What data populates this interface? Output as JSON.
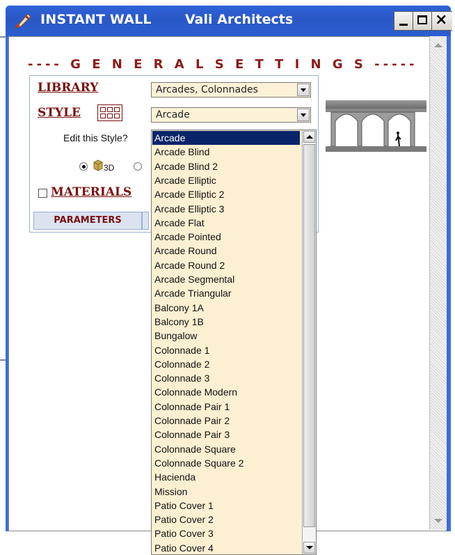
{
  "window": {
    "app_title": "INSTANT WALL",
    "company": "Vali Architects",
    "title_bar_color": "#2a57c6"
  },
  "panel": {
    "section_header": "---- G E N E R A L   S E T T I N G S -----",
    "library_label": "LIBRARY",
    "library_value": "Arcades, Colonnades",
    "style_label": "STYLE",
    "style_value": "Arcade",
    "edit_style_label": "Edit this Style?",
    "label_3d": "3D",
    "materials_label": "MATERIALS",
    "parameters_tab": "PARAMETERS"
  },
  "dropdown": {
    "options": [
      "Arcade",
      "Arcade Blind",
      "Arcade Blind 2",
      "Arcade Elliptic",
      "Arcade Elliptic 2",
      "Arcade Elliptic 3",
      "Arcade Flat",
      "Arcade Pointed",
      "Arcade Round",
      "Arcade Round 2",
      "Arcade Segmental",
      "Arcade Triangular",
      "Balcony 1A",
      "Balcony 1B",
      "Bungalow",
      "Colonnade 1",
      "Colonnade 2",
      "Colonnade 3",
      "Colonnade Modern",
      "Colonnade Pair 1",
      "Colonnade Pair 2",
      "Colonnade Pair 3",
      "Colonnade Square",
      "Colonnade Square 2",
      "Hacienda",
      "Mission",
      "Patio Cover 1",
      "Patio Cover 2",
      "Patio Cover 3",
      "Patio Cover 4"
    ],
    "selected_index": 0
  }
}
